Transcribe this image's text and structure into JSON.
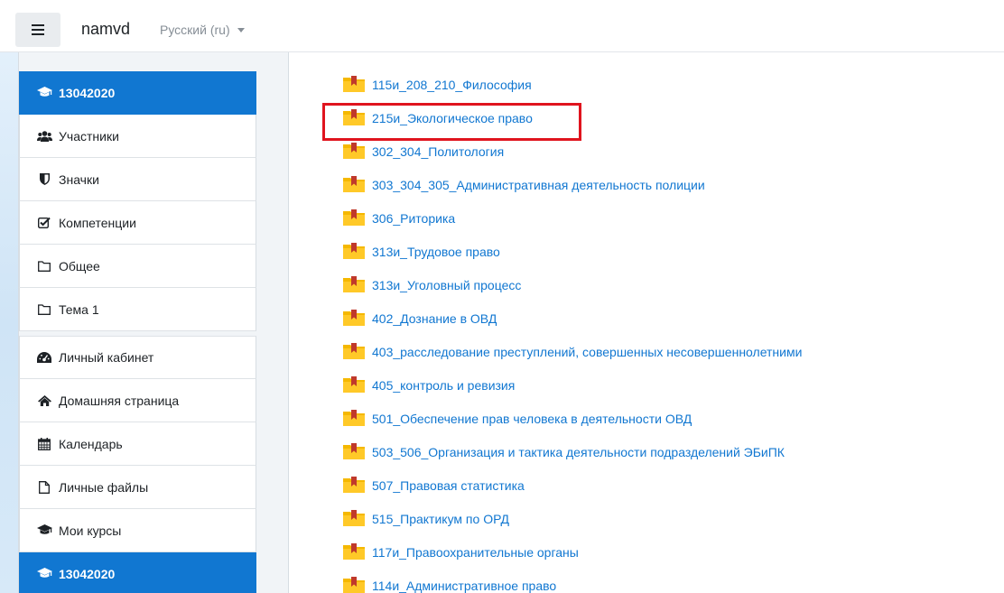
{
  "navbar": {
    "site_name": "namvd",
    "language": "Русский (ru)"
  },
  "sidebar": {
    "items": [
      {
        "label": "13042020",
        "icon": "graduation-cap-icon",
        "active": true
      },
      {
        "label": "Участники",
        "icon": "users-icon"
      },
      {
        "label": "Значки",
        "icon": "shield-icon"
      },
      {
        "label": "Компетенции",
        "icon": "checkbox-icon"
      },
      {
        "label": "Общее",
        "icon": "folder-icon"
      },
      {
        "label": "Тема 1",
        "icon": "folder-icon"
      },
      {
        "label": "Личный кабинет",
        "icon": "dashboard-icon"
      },
      {
        "label": "Домашняя страница",
        "icon": "home-icon"
      },
      {
        "label": "Календарь",
        "icon": "calendar-icon"
      },
      {
        "label": "Личные файлы",
        "icon": "file-icon"
      },
      {
        "label": "Мои курсы",
        "icon": "graduation-cap-icon"
      },
      {
        "label": "13042020",
        "icon": "graduation-cap-icon",
        "active": true
      }
    ]
  },
  "courses": [
    "115и_208_210_Философия",
    "215и_Экологическое право",
    "302_304_Политология",
    "303_304_305_Административная деятельность полиции",
    "306_Риторика",
    "313и_Трудовое право",
    "313и_Уголовный процесс",
    "402_Дознание в ОВД",
    "403_расследование преступлений, совершенных несовершеннолетними",
    "405_контроль и ревизия",
    "501_Обеспечение прав человека в деятельности ОВД",
    "503_506_Организация и тактика деятельности подразделений ЭБиПК",
    "507_Правовая статистика",
    "515_Практикум по ОРД",
    "117и_Правоохранительные органы",
    "114и_Административное право"
  ],
  "colors": {
    "accent": "#1177d1",
    "highlight": "#e0141e",
    "folder": "#f5b800"
  }
}
